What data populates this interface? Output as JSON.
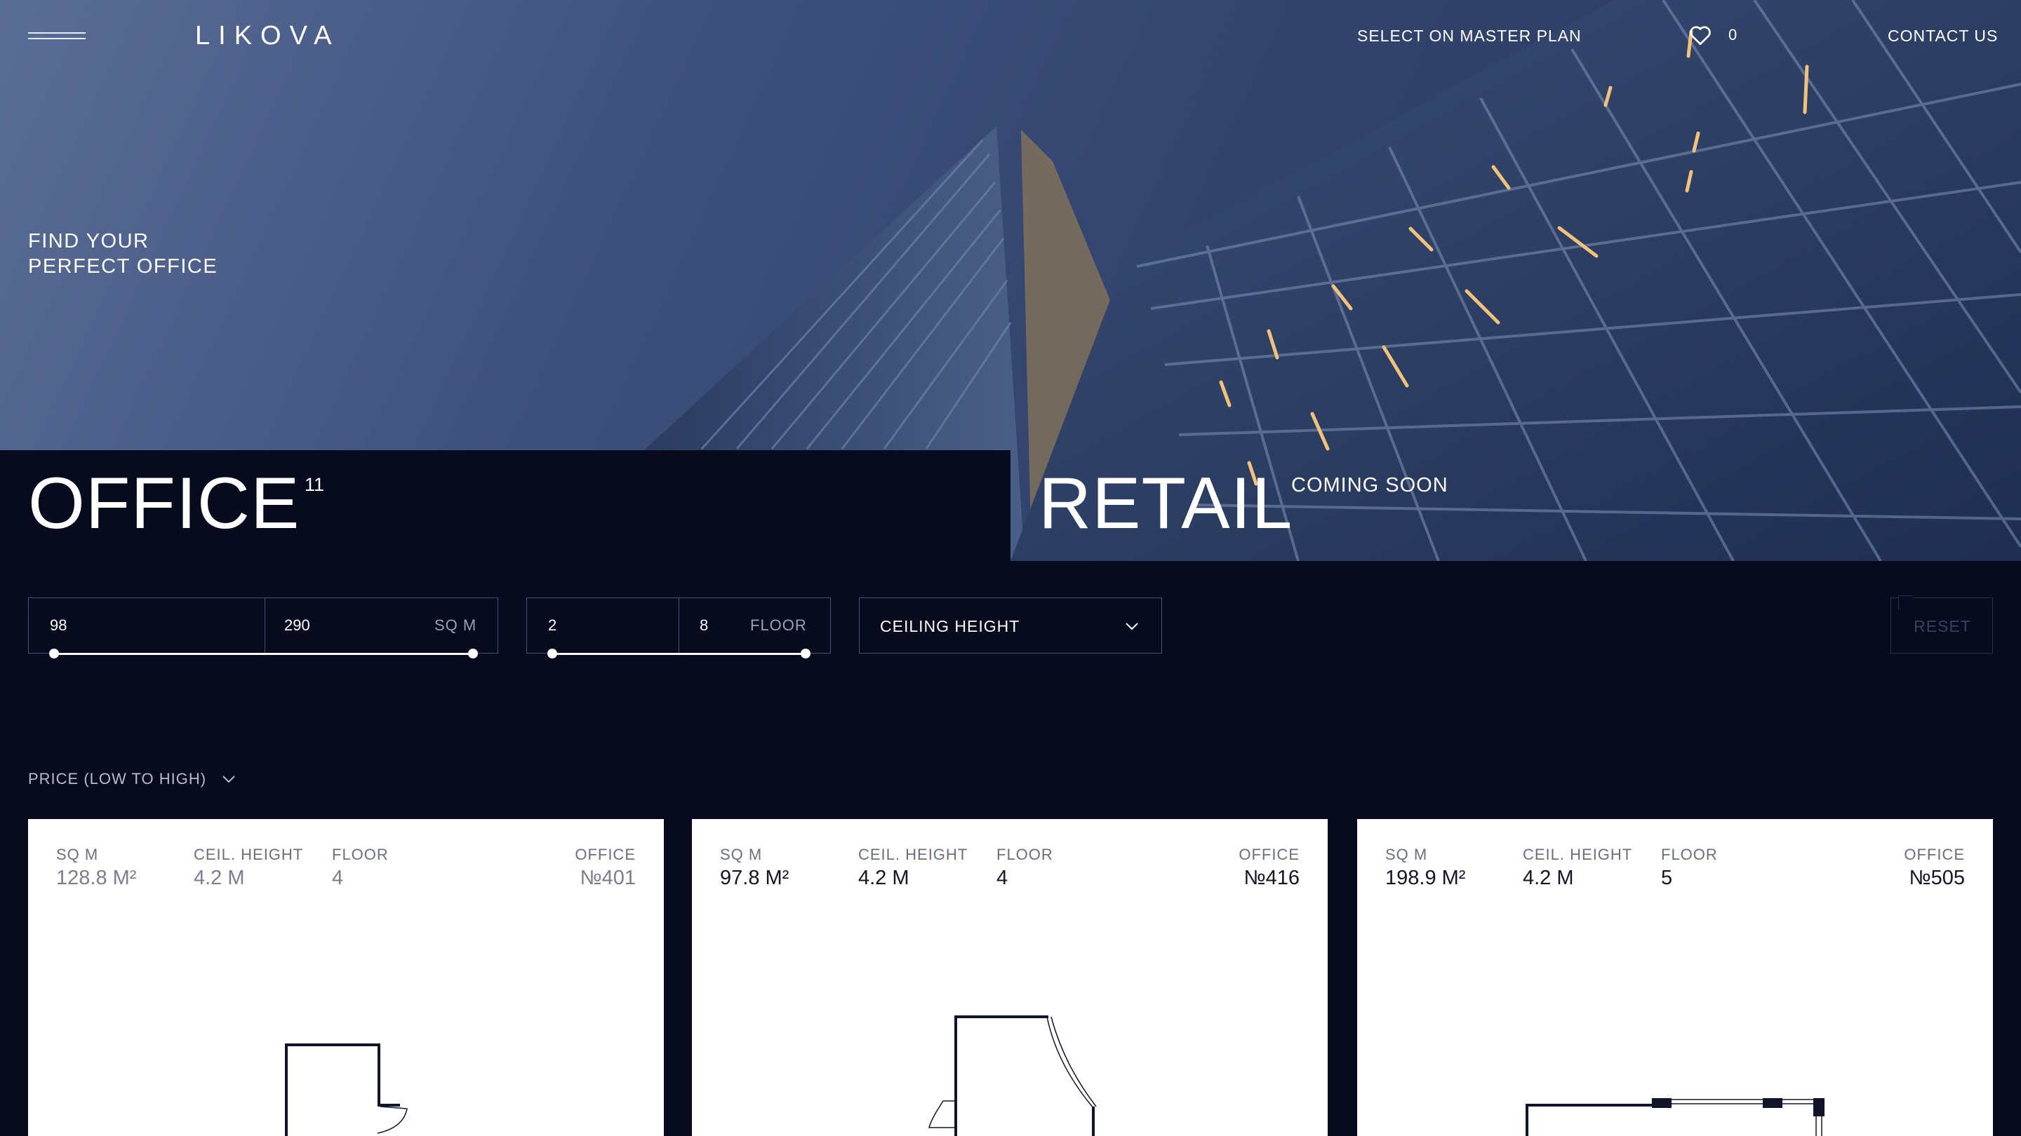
{
  "header": {
    "logo": "LIKOVA",
    "nav_master_plan": "SELECT ON MASTER PLAN",
    "favorites_count": "0",
    "nav_contact": "CONTACT US"
  },
  "hero": {
    "tagline_line1": "FIND YOUR",
    "tagline_line2": "PERFECT OFFICE"
  },
  "tabs": {
    "office_label": "OFFICE",
    "office_count": "11",
    "retail_label": "RETAIL",
    "retail_note": "COMING SOON"
  },
  "filters": {
    "area_min": "98",
    "area_max": "290",
    "area_unit": "SQ M",
    "floor_min": "2",
    "floor_max": "8",
    "floor_unit": "FLOOR",
    "ceiling_label": "CEILING HEIGHT",
    "reset_label": "RESET"
  },
  "sort": {
    "label": "PRICE (LOW TO HIGH)"
  },
  "cards": [
    {
      "area_label": "SQ M",
      "area_value": "128.8 M²",
      "ceiling_label": "CEIL. HEIGHT",
      "ceiling_value": "4.2 M",
      "floor_label": "FLOOR",
      "floor_value": "4",
      "office_label": "OFFICE",
      "office_value": "№401"
    },
    {
      "area_label": "SQ M",
      "area_value": "97.8 M²",
      "ceiling_label": "CEIL. HEIGHT",
      "ceiling_value": "4.2 M",
      "floor_label": "FLOOR",
      "floor_value": "4",
      "office_label": "OFFICE",
      "office_value": "№416"
    },
    {
      "area_label": "SQ M",
      "area_value": "198.9 M²",
      "ceiling_label": "CEIL. HEIGHT",
      "ceiling_value": "4.2 M",
      "floor_label": "FLOOR",
      "floor_value": "5",
      "office_label": "OFFICE",
      "office_value": "№505"
    }
  ],
  "icons": {
    "menu": "hamburger-icon",
    "favorites": "heart-icon",
    "ceiling_dropdown": "chevron-down-icon",
    "sort_dropdown": "chevron-down-icon"
  },
  "colors": {
    "background": "#080a1e",
    "card_background": "#ffffff",
    "hero_sky": "#3f527f"
  }
}
